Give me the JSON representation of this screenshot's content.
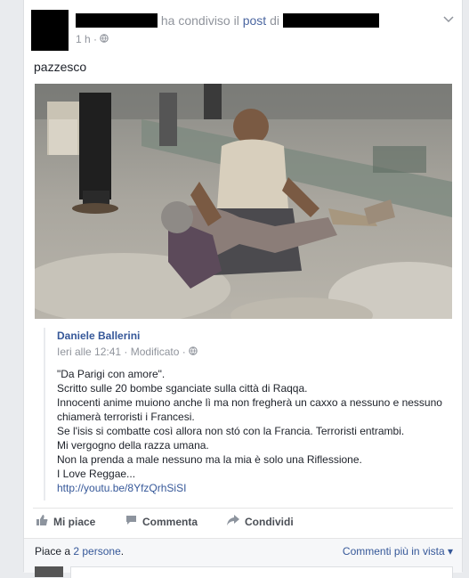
{
  "post": {
    "shared_text": "ha condiviso il",
    "post_link": "post",
    "of_text": "di",
    "time": "1 h",
    "text": "pazzesco"
  },
  "shared_post": {
    "author": "Daniele Ballerini",
    "date": "Ieri alle 12:41",
    "edited": "Modificato",
    "lines": [
      "\"Da Parigi con amore\".",
      "Scritto sulle 20 bombe sganciate sulla città di Raqqa.",
      "Innocenti anime muiono anche lì ma non fregherà un caxxo a nessuno e nessuno chiamerà terroristi i Francesi.",
      "Se l'isis si combatte così allora non stó con la Francia. Terroristi entrambi.",
      "Mi vergogno della razza umana.",
      "Non la prenda a male nessuno ma la mia è solo una Riflessione.",
      "I Love Reggae..."
    ],
    "link": "http://youtu.be/8YfzQrhSiSI"
  },
  "actions": {
    "like": "Mi piace",
    "comment": "Commenta",
    "share": "Condividi"
  },
  "footer": {
    "likes_prefix": "Piace a",
    "likes_link": "2 persone",
    "likes_suffix": ".",
    "comments_view": "Commenti più in vista"
  }
}
